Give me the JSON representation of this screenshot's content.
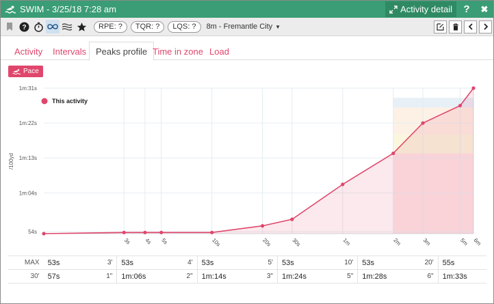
{
  "window": {
    "title": "SWIM - 3/25/18 7:28 am",
    "detail_label": "Activity detail",
    "help_label": "?",
    "close_label": "✖"
  },
  "toolbar": {
    "rpe_label": "RPE: ?",
    "tqr_label": "TQR: ?",
    "lqs_label": "LQS: ?",
    "location": "8m - Fremantle City"
  },
  "tabs": [
    {
      "label": "Activity",
      "active": false
    },
    {
      "label": "Intervals",
      "active": false
    },
    {
      "label": "Peaks profile",
      "active": true
    },
    {
      "label": "Time in zone",
      "active": false
    },
    {
      "label": "Load",
      "active": false
    }
  ],
  "pace_button_label": "Pace",
  "colors": {
    "accent": "#e0466c",
    "titlebar": "#3a9d75",
    "zone_red": "#fde3e5",
    "zone_yellow": "#f9f6da",
    "zone_orange": "#fdf0e2",
    "zone_blue": "#e6eef6"
  },
  "chart_data": {
    "type": "line",
    "ylabel": "/100yd",
    "y_ticks": [
      "1m:31s",
      "1m:22s",
      "1m:13s",
      "1m:04s",
      "54s"
    ],
    "y_tick_seconds": [
      91,
      82,
      73,
      64,
      54
    ],
    "ylim": [
      53.5,
      91
    ],
    "x_ticks": [
      "3s",
      "4s",
      "5s",
      "10s",
      "20s",
      "30s",
      "1m",
      "2m",
      "3m",
      "5m",
      "6m"
    ],
    "x_tick_seconds": [
      3,
      4,
      5,
      10,
      20,
      30,
      60,
      120,
      180,
      300,
      360
    ],
    "series": [
      {
        "name": "This activity",
        "x": [
          1,
          3,
          4,
          5,
          10,
          20,
          30,
          60,
          120,
          180,
          300,
          360
        ],
        "y": [
          53.5,
          53.8,
          53.8,
          53.8,
          53.8,
          55.5,
          57.2,
          66.2,
          74.2,
          82.0,
          86.5,
          91.0
        ]
      }
    ]
  },
  "stats": {
    "rows": [
      [
        {
          "dur": "MAX",
          "val": "53s"
        },
        {
          "dur": "3'",
          "val": "53s"
        },
        {
          "dur": "4'",
          "val": "53s"
        },
        {
          "dur": "5'",
          "val": "53s"
        },
        {
          "dur": "10'",
          "val": "53s"
        },
        {
          "dur": "20'",
          "val": "55s"
        }
      ],
      [
        {
          "dur": "30'",
          "val": "57s"
        },
        {
          "dur": "1\"",
          "val": "1m:06s"
        },
        {
          "dur": "2\"",
          "val": "1m:14s"
        },
        {
          "dur": "3\"",
          "val": "1m:24s"
        },
        {
          "dur": "5\"",
          "val": "1m:28s"
        },
        {
          "dur": "6\"",
          "val": "1m:33s"
        }
      ]
    ]
  }
}
